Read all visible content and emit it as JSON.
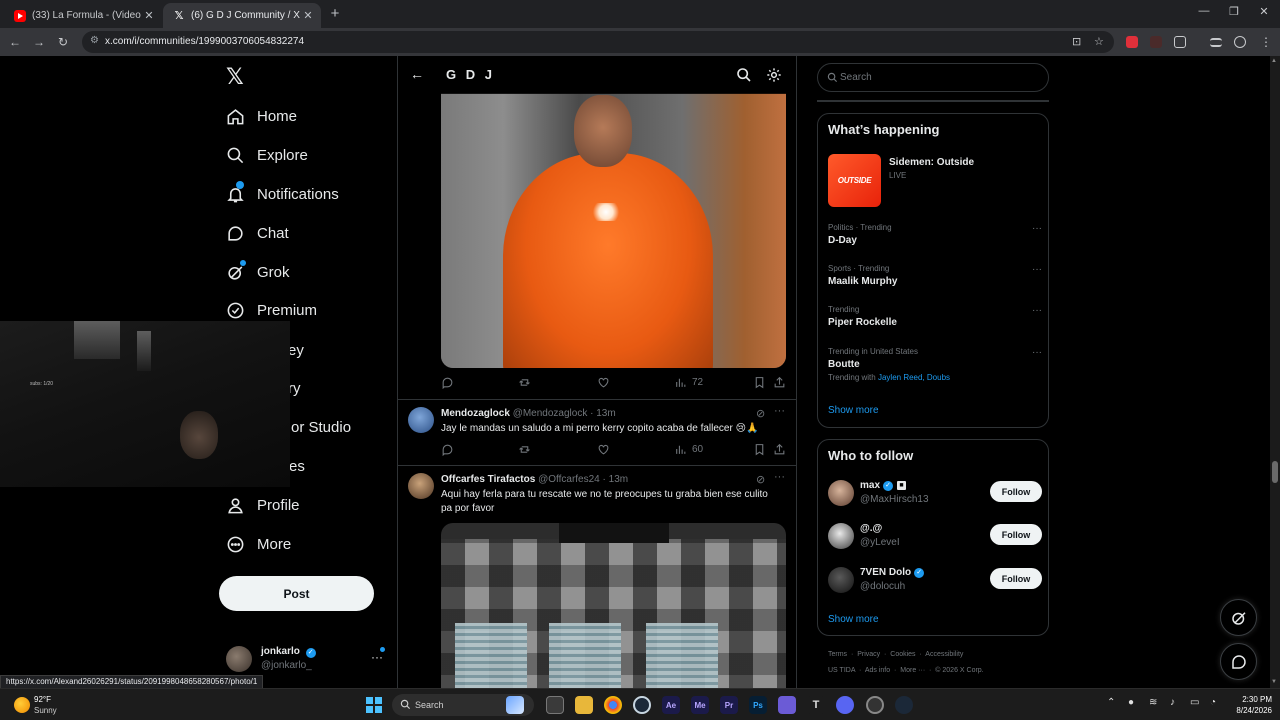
{
  "browser": {
    "tabs": [
      {
        "title": "(33) La Formula - (Video Oficial)",
        "favicon": "youtube-icon",
        "active": false
      },
      {
        "title": "(6) G D J Community / X",
        "favicon": "x-icon",
        "active": true
      }
    ],
    "url": "x.com/i/communities/1999003706054832274",
    "status_url": "https://x.com/Alexand26026291/status/2091998048658280567/photo/1"
  },
  "nav": {
    "items": [
      {
        "label": "Home",
        "icon": "home-icon"
      },
      {
        "label": "Explore",
        "icon": "search-icon"
      },
      {
        "label": "Notifications",
        "icon": "bell-icon"
      },
      {
        "label": "Chat",
        "icon": "chat-icon"
      },
      {
        "label": "Grok",
        "icon": "grok-icon"
      },
      {
        "label": "Premium",
        "icon": "premium-icon"
      },
      {
        "label": "ey",
        "icon": ""
      },
      {
        "label": "ry",
        "icon": ""
      },
      {
        "label": "or Studio",
        "icon": ""
      },
      {
        "label": "es",
        "icon": ""
      },
      {
        "label": "Profile",
        "icon": "person-icon"
      },
      {
        "label": "More",
        "icon": "more-circle-icon"
      }
    ],
    "post_label": "Post",
    "account": {
      "name": "jonkarlo",
      "handle": "@jonkarlo_"
    }
  },
  "webcam": {
    "overlay_text": "subs: 1/20"
  },
  "community": {
    "title": "G D J",
    "first_post_actions": {
      "views": "72"
    },
    "tweets": [
      {
        "name": "Mendozaglock",
        "handle": "@Mendozaglock",
        "time": "· 13m",
        "text": "Jay le mandas un saludo a mi perro kerry copito acaba de fallecer 😢🙏",
        "views": "60"
      },
      {
        "name": "Offcarfes Tirafactos",
        "handle": "@Offcarfes24",
        "time": "· 13m",
        "text": "Aqui hay ferla para tu rescate we no te preocupes tu graba bien ese culito pa por favor"
      }
    ]
  },
  "sidebar": {
    "search_placeholder": "Search",
    "happening": {
      "title": "What’s happening",
      "live": {
        "title": "Sidemen: Outside",
        "status": "LIVE",
        "thumb_text": "OUTSIDE"
      },
      "trends": [
        {
          "meta": "Politics · Trending",
          "topic": "D-Day"
        },
        {
          "meta": "Sports · Trending",
          "topic": "Maalik Murphy"
        },
        {
          "meta": "Trending",
          "topic": "Piper Rockelle"
        },
        {
          "meta": "Trending in United States",
          "topic": "Boutte",
          "with_prefix": "Trending with",
          "with_links": "Jaylen Reed, Doubs"
        }
      ],
      "show_more": "Show more"
    },
    "who_to_follow": {
      "title": "Who to follow",
      "accounts": [
        {
          "name": "max",
          "handle": "@MaxHirsch13",
          "follow": "Follow"
        },
        {
          "name": "@.@",
          "handle": "@yLeveI",
          "follow": "Follow"
        },
        {
          "name": "7VEN Dolo",
          "handle": "@dolocuh",
          "follow": "Follow"
        }
      ],
      "show_more": "Show more"
    },
    "footer": {
      "line1": [
        "Terms",
        "Privacy",
        "Cookies",
        "Accessibility"
      ],
      "line2": [
        "US TIDA",
        "Ads info",
        "More ···",
        "© 2026 X Corp."
      ]
    }
  },
  "taskbar": {
    "weather_temp": "92°F",
    "weather_desc": "Sunny",
    "search_placeholder": "Search",
    "time": "2:30 PM",
    "date": "8/24/2026"
  },
  "colors": {
    "accent": "#1d9bf0",
    "background": "#000000",
    "border": "#2f3336",
    "muted": "#71767b"
  }
}
